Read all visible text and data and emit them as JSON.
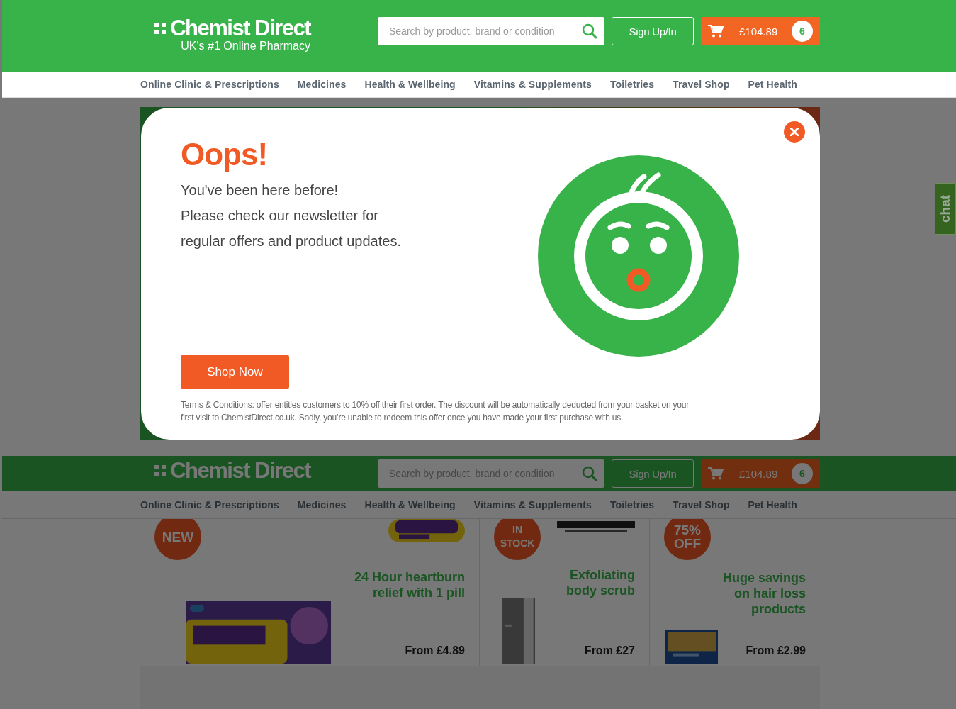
{
  "header": {
    "logo": "Chemist Direct",
    "tagline": "UK's #1 Online Pharmacy",
    "search": {
      "placeholder": "Search by product, brand or condition"
    },
    "sign_in": "Sign Up/In",
    "basket": {
      "total": "£104.89",
      "count": "6"
    }
  },
  "nav": [
    "Online Clinic & Prescriptions",
    "Medicines",
    "Health & Wellbeing",
    "Vitamins & Supplements",
    "Toiletries",
    "Travel Shop",
    "Pet Health"
  ],
  "modal": {
    "title": "Oops!",
    "lines": [
      "You've been here before!",
      "Please check our newsletter for",
      "regular offers and product updates."
    ],
    "button": "Shop Now",
    "terms": "Terms & Conditions: offer entitles customers to 10% off their first order. The discount will be automatically deducted from your basket on your first visit to ChemistDirect.co.uk. Sadly, you’re unable to redeem this offer once you have made your first purchase with us."
  },
  "sticky_header": {
    "logo": "Chemist Direct",
    "search": {
      "placeholder": "Search by product, brand or condition"
    },
    "sign_in": "Sign Up/In",
    "basket": {
      "total": "£104.89",
      "count": "6"
    }
  },
  "sticky_nav": [
    "Online Clinic & Prescriptions",
    "Medicines",
    "Health & Wellbeing",
    "Vitamins & Supplements",
    "Toiletries",
    "Travel Shop",
    "Pet Health"
  ],
  "promos": [
    {
      "kind": "wide",
      "badge": [
        "NEW"
      ],
      "headline": [
        "24 Hour heartburn",
        "relief with 1 pill"
      ],
      "price": "From £4.89"
    },
    {
      "kind": "tube",
      "badge": [
        "IN",
        "STOCK"
      ],
      "headline": [
        "Exfoliating",
        "body scrub"
      ],
      "price": "From £27"
    },
    {
      "kind": "box",
      "badge": [
        "75%",
        "OFF"
      ],
      "headline": [
        "Huge savings",
        "on hair loss",
        "products"
      ],
      "price": "From £2.99"
    }
  ],
  "chat": "chat"
}
